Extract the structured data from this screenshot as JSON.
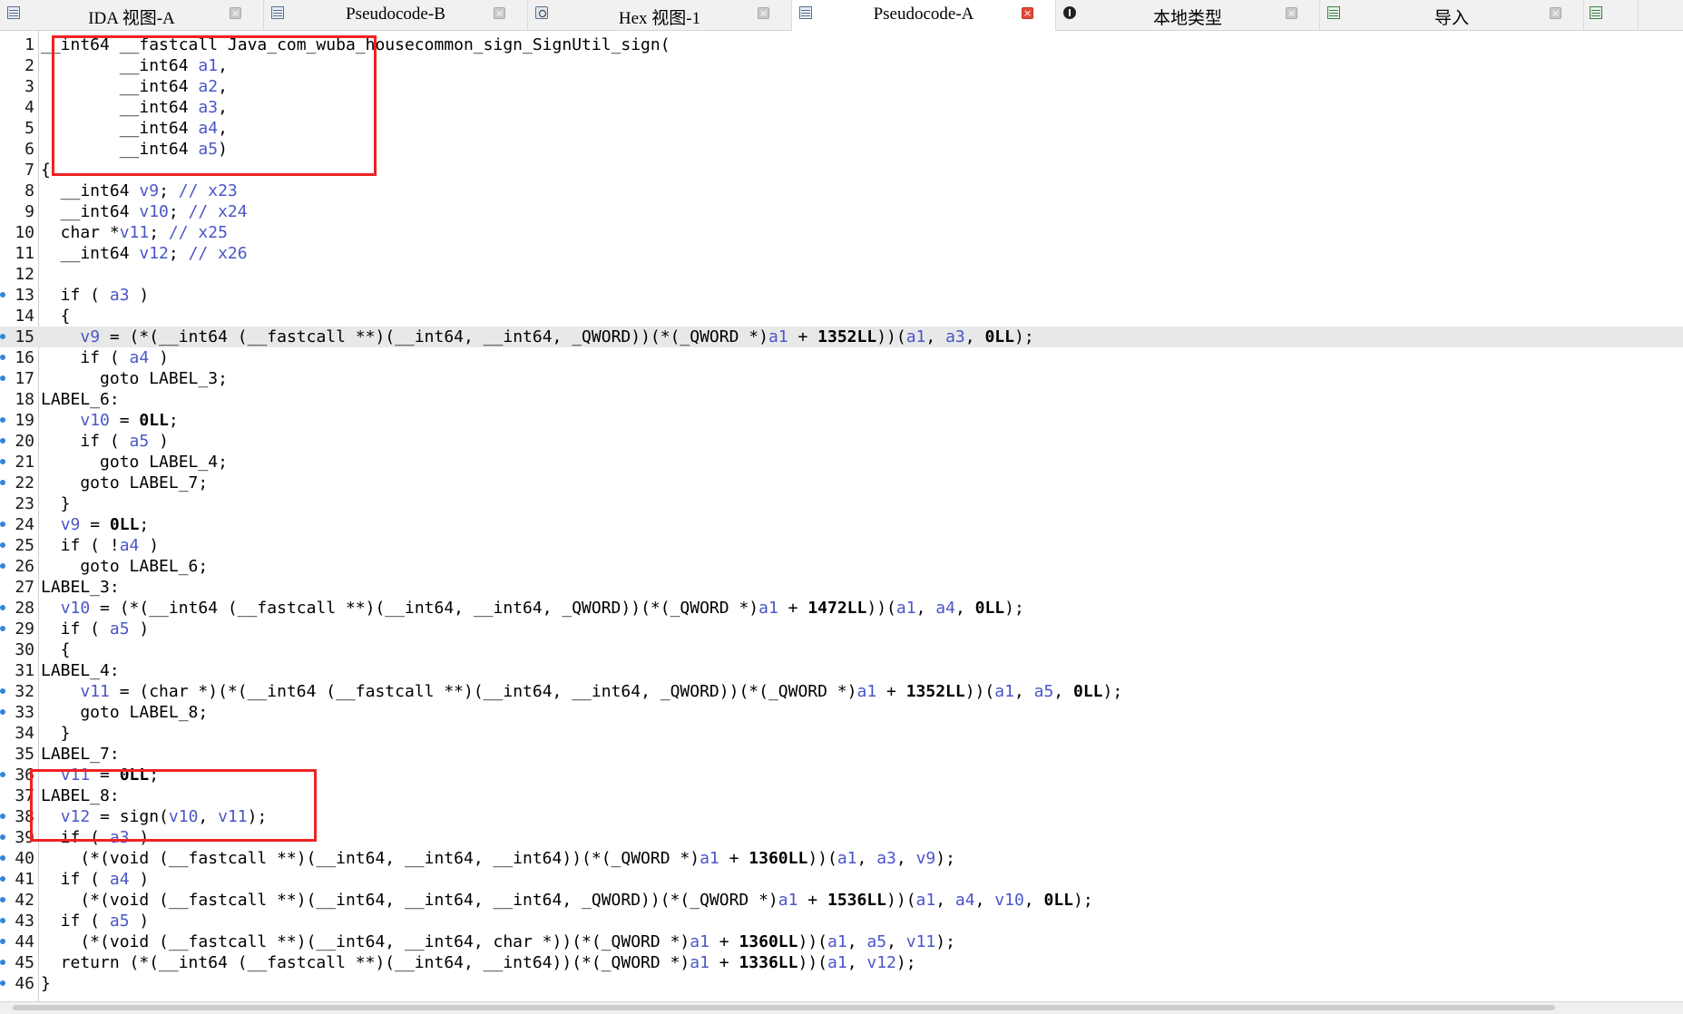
{
  "tabs": [
    {
      "label": "IDA 视图-A",
      "icon": "disassembly-view-icon",
      "active": false
    },
    {
      "label": "Pseudocode-B",
      "icon": "pseudocode-icon",
      "active": false
    },
    {
      "label": "Hex 视图-1",
      "icon": "hex-view-icon",
      "active": false
    },
    {
      "label": "Pseudocode-A",
      "icon": "pseudocode-icon",
      "active": true
    },
    {
      "label": "本地类型",
      "icon": "local-types-icon",
      "active": false
    },
    {
      "label": "导入",
      "icon": "imports-icon",
      "active": false
    }
  ],
  "tab_overflow_icon": "exports-icon",
  "highlighted_line": 15,
  "colors": {
    "variable": "#4a56c8",
    "comment": "#4a56c8",
    "highlight": "#e8e8e8",
    "annotation": "#f02222",
    "breakpoint_dot": "#2e86de"
  },
  "lines": [
    {
      "n": "1",
      "dot": false,
      "code": "__int64 __fastcall Java_com_wuba_housecommon_sign_SignUtil_sign("
    },
    {
      "n": "2",
      "dot": false,
      "code": "        __int64 a1,"
    },
    {
      "n": "3",
      "dot": false,
      "code": "        __int64 a2,"
    },
    {
      "n": "4",
      "dot": false,
      "code": "        __int64 a3,"
    },
    {
      "n": "5",
      "dot": false,
      "code": "        __int64 a4,"
    },
    {
      "n": "6",
      "dot": false,
      "code": "        __int64 a5)"
    },
    {
      "n": "7",
      "dot": false,
      "code": "{"
    },
    {
      "n": "8",
      "dot": false,
      "code": "  __int64 v9; // x23"
    },
    {
      "n": "9",
      "dot": false,
      "code": "  __int64 v10; // x24"
    },
    {
      "n": "10",
      "dot": false,
      "code": "  char *v11; // x25"
    },
    {
      "n": "11",
      "dot": false,
      "code": "  __int64 v12; // x26"
    },
    {
      "n": "12",
      "dot": false,
      "code": ""
    },
    {
      "n": "13",
      "dot": true,
      "code": "  if ( a3 )"
    },
    {
      "n": "14",
      "dot": false,
      "code": "  {"
    },
    {
      "n": "15",
      "dot": true,
      "code": "    v9 = (*(__int64 (__fastcall **)(__int64, __int64, _QWORD))(*(_QWORD *)a1 + 1352LL))(a1, a3, 0LL);"
    },
    {
      "n": "16",
      "dot": true,
      "code": "    if ( a4 )"
    },
    {
      "n": "17",
      "dot": true,
      "code": "      goto LABEL_3;"
    },
    {
      "n": "18",
      "dot": false,
      "code": "LABEL_6:"
    },
    {
      "n": "19",
      "dot": true,
      "code": "    v10 = 0LL;"
    },
    {
      "n": "20",
      "dot": true,
      "code": "    if ( a5 )"
    },
    {
      "n": "21",
      "dot": true,
      "code": "      goto LABEL_4;"
    },
    {
      "n": "22",
      "dot": true,
      "code": "    goto LABEL_7;"
    },
    {
      "n": "23",
      "dot": false,
      "code": "  }"
    },
    {
      "n": "24",
      "dot": true,
      "code": "  v9 = 0LL;"
    },
    {
      "n": "25",
      "dot": true,
      "code": "  if ( !a4 )"
    },
    {
      "n": "26",
      "dot": true,
      "code": "    goto LABEL_6;"
    },
    {
      "n": "27",
      "dot": false,
      "code": "LABEL_3:"
    },
    {
      "n": "28",
      "dot": true,
      "code": "  v10 = (*(__int64 (__fastcall **)(__int64, __int64, _QWORD))(*(_QWORD *)a1 + 1472LL))(a1, a4, 0LL);"
    },
    {
      "n": "29",
      "dot": true,
      "code": "  if ( a5 )"
    },
    {
      "n": "30",
      "dot": false,
      "code": "  {"
    },
    {
      "n": "31",
      "dot": false,
      "code": "LABEL_4:"
    },
    {
      "n": "32",
      "dot": true,
      "code": "    v11 = (char *)(*(__int64 (__fastcall **)(__int64, __int64, _QWORD))(*(_QWORD *)a1 + 1352LL))(a1, a5, 0LL);"
    },
    {
      "n": "33",
      "dot": true,
      "code": "    goto LABEL_8;"
    },
    {
      "n": "34",
      "dot": false,
      "code": "  }"
    },
    {
      "n": "35",
      "dot": false,
      "code": "LABEL_7:"
    },
    {
      "n": "36",
      "dot": true,
      "code": "  v11 = 0LL;"
    },
    {
      "n": "37",
      "dot": false,
      "code": "LABEL_8:"
    },
    {
      "n": "38",
      "dot": true,
      "code": "  v12 = sign(v10, v11);"
    },
    {
      "n": "39",
      "dot": true,
      "code": "  if ( a3 )"
    },
    {
      "n": "40",
      "dot": true,
      "code": "    (*(void (__fastcall **)(__int64, __int64, __int64))(*(_QWORD *)a1 + 1360LL))(a1, a3, v9);"
    },
    {
      "n": "41",
      "dot": true,
      "code": "  if ( a4 )"
    },
    {
      "n": "42",
      "dot": true,
      "code": "    (*(void (__fastcall **)(__int64, __int64, __int64, _QWORD))(*(_QWORD *)a1 + 1536LL))(a1, a4, v10, 0LL);"
    },
    {
      "n": "43",
      "dot": true,
      "code": "  if ( a5 )"
    },
    {
      "n": "44",
      "dot": true,
      "code": "    (*(void (__fastcall **)(__int64, __int64, char *))(*(_QWORD *)a1 + 1360LL))(a1, a5, v11);"
    },
    {
      "n": "45",
      "dot": true,
      "code": "  return (*(__int64 (__fastcall **)(__int64, __int64))(*(_QWORD *)a1 + 1336LL))(a1, v12);"
    },
    {
      "n": "46",
      "dot": true,
      "code": "}"
    }
  ]
}
